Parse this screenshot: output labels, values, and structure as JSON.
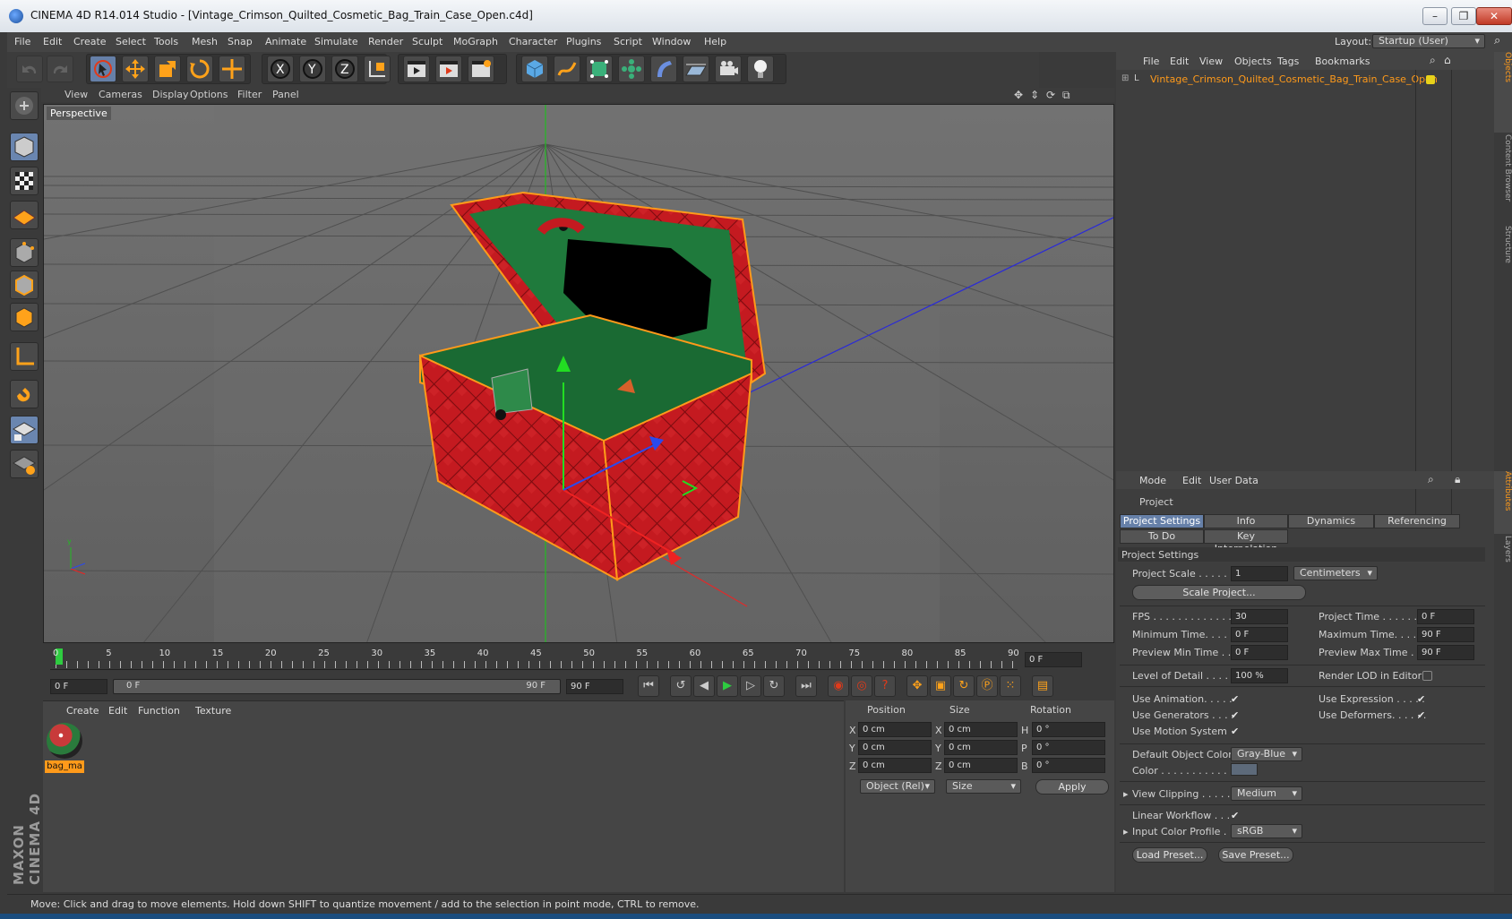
{
  "window": {
    "title": "CINEMA 4D R14.014 Studio - [Vintage_Crimson_Quilted_Cosmetic_Bag_Train_Case_Open.c4d]"
  },
  "menu": [
    "File",
    "Edit",
    "Create",
    "Select",
    "Tools",
    "Mesh",
    "Snap",
    "Animate",
    "Simulate",
    "Render",
    "Sculpt",
    "MoGraph",
    "Character",
    "Plugins",
    "Script",
    "Window",
    "Help"
  ],
  "layout": {
    "label": "Layout:",
    "value": "Startup (User)"
  },
  "viewport": {
    "menu": [
      "View",
      "Cameras",
      "Display",
      "Options",
      "Filter",
      "Panel"
    ],
    "camera_label": "Perspective"
  },
  "timeline": {
    "ticks": [
      "0",
      "5",
      "10",
      "15",
      "20",
      "25",
      "30",
      "35",
      "40",
      "45",
      "50",
      "55",
      "60",
      "65",
      "70",
      "75",
      "80",
      "85",
      "90"
    ],
    "current_frame": "0 F",
    "start": "0 F",
    "slider_start": "0 F",
    "slider_end": "90 F",
    "end": "90 F"
  },
  "material_manager": {
    "menu": [
      "Create",
      "Edit",
      "Function",
      "Texture"
    ],
    "material_name": "bag_ma"
  },
  "coordinates": {
    "headers": [
      "Position",
      "Size",
      "Rotation"
    ],
    "rows": [
      {
        "axis": "X",
        "pos": "0 cm",
        "size_axis": "X",
        "size": "0 cm",
        "rot_axis": "H",
        "rot": "0 °"
      },
      {
        "axis": "Y",
        "pos": "0 cm",
        "size_axis": "Y",
        "size": "0 cm",
        "rot_axis": "P",
        "rot": "0 °"
      },
      {
        "axis": "Z",
        "pos": "0 cm",
        "size_axis": "Z",
        "size": "0 cm",
        "rot_axis": "B",
        "rot": "0 °"
      }
    ],
    "mode": "Object (Rel)",
    "size_mode": "Size",
    "apply": "Apply"
  },
  "object_manager": {
    "menu": [
      "File",
      "Edit",
      "View",
      "Objects",
      "Tags",
      "Bookmarks"
    ],
    "object_name": "Vintage_Crimson_Quilted_Cosmetic_Bag_Train_Case_Open"
  },
  "attributes": {
    "menu": [
      "Mode",
      "Edit",
      "User Data"
    ],
    "header": "Project",
    "tabs_row1": [
      "Project Settings",
      "Info",
      "Dynamics",
      "Referencing"
    ],
    "tabs_row2": [
      "To Do",
      "Key Interpolation"
    ],
    "section": "Project Settings",
    "project_scale": {
      "label": "Project Scale . . . . . .",
      "value": "1",
      "unit": "Centimeters"
    },
    "scale_project": "Scale Project...",
    "fps": {
      "label": "FPS . . . . . . . . . . . . . .",
      "value": "30"
    },
    "project_time": {
      "label": "Project Time . . . . . . .",
      "value": "0 F"
    },
    "min_time": {
      "label": "Minimum Time. . . . . .",
      "value": "0 F"
    },
    "max_time": {
      "label": "Maximum Time. . . . . .",
      "value": "90 F"
    },
    "preview_min": {
      "label": "Preview Min Time . . .",
      "value": "0 F"
    },
    "preview_max": {
      "label": "Preview Max Time . . .",
      "value": "90 F"
    },
    "lod": {
      "label": "Level of Detail . . . . . .",
      "value": "100 %"
    },
    "render_lod": "Render LOD in Editor",
    "use_animation": "Use Animation. . . . .",
    "use_expression": "Use Expression . . . . .",
    "use_generators": "Use Generators . . . .",
    "use_deformers": "Use Deformers. . . . . .",
    "use_motion": "Use Motion System",
    "default_color": {
      "label": "Default Object Color",
      "value": "Gray-Blue"
    },
    "color_label": "Color . . . . . . . . . . .",
    "view_clipping": {
      "label": "View Clipping . . . . .",
      "value": "Medium"
    },
    "linear_workflow": "Linear Workflow . . .",
    "input_profile": {
      "label": "Input Color Profile .",
      "value": "sRGB"
    },
    "load_preset": "Load Preset...",
    "save_preset": "Save Preset..."
  },
  "side_tabs": [
    "Objects",
    "Content Browser",
    "Structure",
    "Attributes",
    "Layers"
  ],
  "status": "Move: Click and drag to move elements. Hold down SHIFT to quantize movement / add to the selection in point mode, CTRL to remove.",
  "brand": "MAXON CINEMA 4D",
  "colors": {
    "accent_orange": "#ff9a1a",
    "selection_blue": "#6680a8",
    "case_red": "#c8181f",
    "lining_green": "#1e7a3c"
  }
}
